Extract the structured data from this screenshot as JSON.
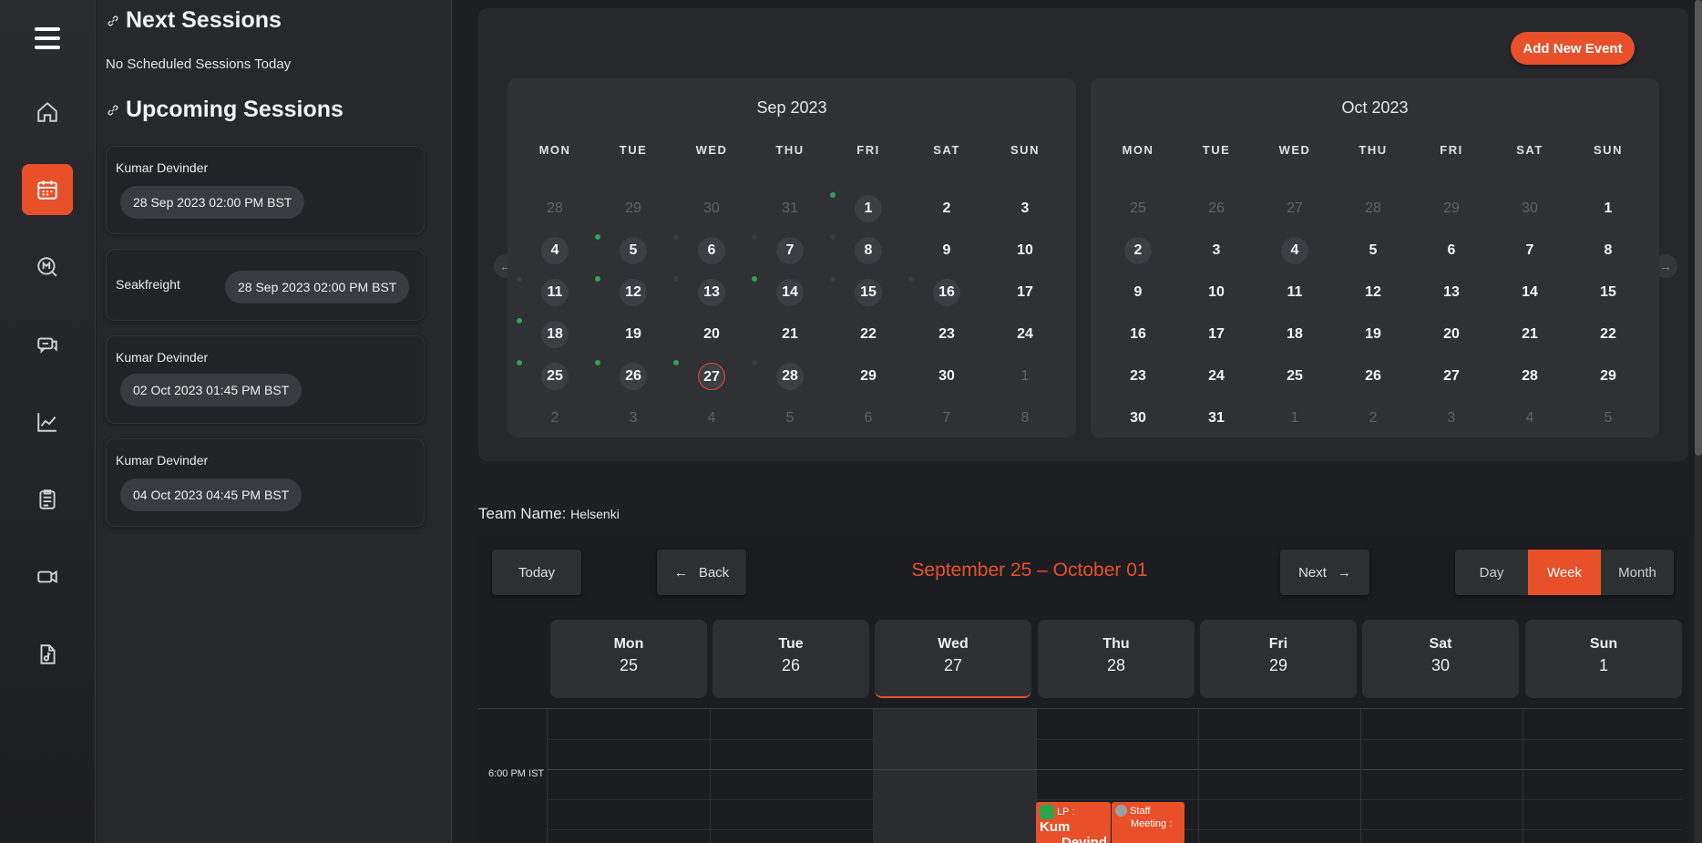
{
  "sidebar": {
    "icons": [
      "menu-icon",
      "home-icon",
      "calendar-icon",
      "metrics-icon",
      "chat-icon",
      "chart-icon",
      "clipboard-icon",
      "video-icon",
      "music-file-icon"
    ],
    "active": "calendar-icon"
  },
  "sessions": {
    "next_title": "Next Sessions",
    "no_sessions": "No Scheduled Sessions Today",
    "upcoming_title": "Upcoming Sessions",
    "cards": [
      {
        "name": "Kumar Devinder",
        "time": "28 Sep 2023 02:00 PM BST"
      },
      {
        "name": "Seakfreight",
        "time": "28 Sep 2023 02:00 PM BST"
      },
      {
        "name": "Kumar Devinder",
        "time": "02 Oct 2023 01:45 PM BST"
      },
      {
        "name": "Kumar Devinder",
        "time": "04 Oct 2023 04:45 PM BST"
      }
    ]
  },
  "calendar": {
    "add_event": "Add New Event",
    "weekdays": [
      "MON",
      "TUE",
      "WED",
      "THU",
      "FRI",
      "SAT",
      "SUN"
    ],
    "prev_icon": "arrow-left-icon",
    "next_icon": "arrow-right-icon",
    "months": [
      {
        "title": "Sep 2023",
        "weeks": [
          [
            "28",
            "29",
            "30",
            "31",
            "1",
            "2",
            "3"
          ],
          [
            "4",
            "5",
            "6",
            "7",
            "8",
            "9",
            "10"
          ],
          [
            "11",
            "12",
            "13",
            "14",
            "15",
            "16",
            "17"
          ],
          [
            "18",
            "19",
            "20",
            "21",
            "22",
            "23",
            "24"
          ],
          [
            "25",
            "26",
            "27",
            "28",
            "29",
            "30",
            "1"
          ],
          [
            "2",
            "3",
            "4",
            "5",
            "6",
            "7",
            "8"
          ]
        ]
      },
      {
        "title": "Oct 2023",
        "weeks": [
          [
            "25",
            "26",
            "27",
            "28",
            "29",
            "30",
            "1"
          ],
          [
            "2",
            "3",
            "4",
            "5",
            "6",
            "7",
            "8"
          ],
          [
            "9",
            "10",
            "11",
            "12",
            "13",
            "14",
            "15"
          ],
          [
            "16",
            "17",
            "18",
            "19",
            "20",
            "21",
            "22"
          ],
          [
            "23",
            "24",
            "25",
            "26",
            "27",
            "28",
            "29"
          ],
          [
            "30",
            "31",
            "1",
            "2",
            "3",
            "4",
            "5"
          ]
        ]
      }
    ]
  },
  "team": {
    "label": "Team Name:",
    "value": "Helsenki"
  },
  "week": {
    "today": "Today",
    "back": "Back",
    "next": "Next",
    "range": "September 25 – October 01",
    "views": [
      "Day",
      "Week",
      "Month"
    ],
    "active_view": "Week",
    "days": [
      {
        "name": "Mon",
        "date": "25"
      },
      {
        "name": "Tue",
        "date": "26"
      },
      {
        "name": "Wed",
        "date": "27"
      },
      {
        "name": "Thu",
        "date": "28"
      },
      {
        "name": "Fri",
        "date": "29"
      },
      {
        "name": "Sat",
        "date": "30"
      },
      {
        "name": "Sun",
        "date": "1"
      }
    ],
    "time_label": "6:00 PM IST",
    "events": [
      {
        "prefix": "LP :",
        "title": "Kum",
        "title2": "Devind"
      },
      {
        "title": "Staff",
        "title2": "Meeting :"
      }
    ]
  },
  "colors": {
    "accent": "#e8502a",
    "event_dot": "#2ea44f",
    "bg": "#1e1f22"
  }
}
